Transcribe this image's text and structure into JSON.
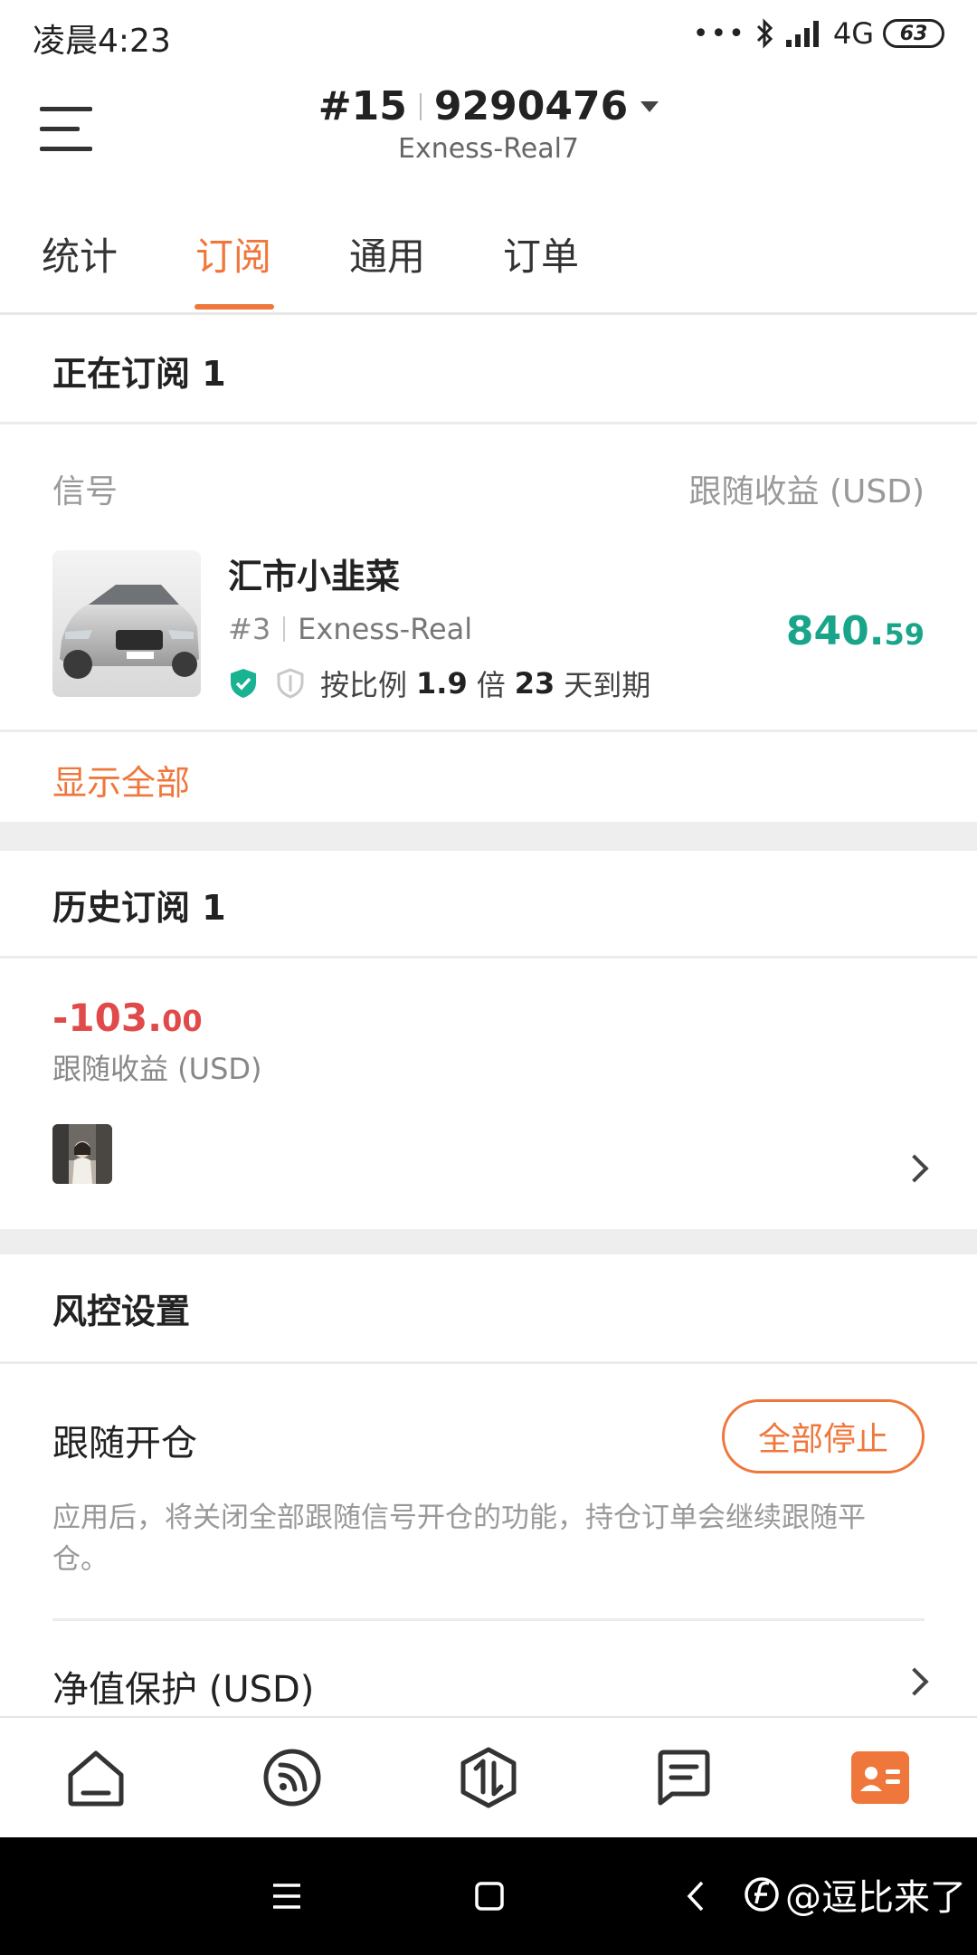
{
  "status_bar": {
    "time": "凌晨4:23",
    "signal": "4G",
    "battery": "63"
  },
  "header": {
    "account_rank": "#15",
    "account_number": "9290476",
    "server": "Exness-Real7"
  },
  "tabs": [
    {
      "label": "统计",
      "active": false
    },
    {
      "label": "订阅",
      "active": true
    },
    {
      "label": "通用",
      "active": false
    },
    {
      "label": "订单",
      "active": false
    }
  ],
  "current": {
    "title": "正在订阅 1",
    "col_signal": "信号",
    "col_profit": "跟随收益 (USD)",
    "signal": {
      "name": "汇市小韭菜",
      "rank": "#3",
      "server": "Exness-Real",
      "ratio_prefix": "按比例",
      "ratio": "1.9",
      "ratio_unit": "倍",
      "days": "23",
      "days_suffix": "天到期",
      "profit_int": "840.",
      "profit_dec": "59"
    },
    "show_all": "显示全部"
  },
  "history": {
    "title": "历史订阅 1",
    "profit_int": "-103.",
    "profit_dec": "00",
    "profit_label": "跟随收益 (USD)"
  },
  "risk": {
    "title": "风控设置",
    "follow_open_label": "跟随开仓",
    "stop_all": "全部停止",
    "description": "应用后，将关闭全部跟随信号开仓的功能，持仓订单会继续跟随平仓。",
    "equity_protection": "净值保护 (USD)"
  },
  "nav": [
    "home-icon",
    "signal-feed-icon",
    "trade-icon",
    "messages-icon",
    "profile-card-icon"
  ],
  "watermark": "@逗比来了",
  "colors": {
    "accent": "#f0773c",
    "profit": "#19a58a",
    "loss": "#e04a4a"
  }
}
